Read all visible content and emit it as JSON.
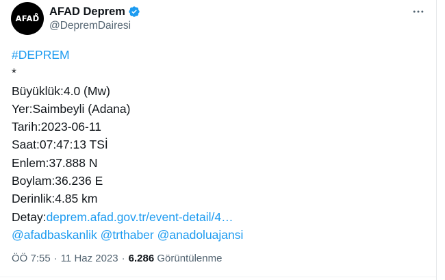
{
  "author": {
    "avatar_text": "AFAD",
    "display_name": "AFAD Deprem",
    "handle": "@DepremDairesi",
    "verified_color": "#1d9bf0"
  },
  "tweet": {
    "hashtag": "#DEPREM",
    "asterisk": "*",
    "magnitude": "Büyüklük:4.0 (Mw)",
    "location": "Yer:Saimbeyli (Adana)",
    "date": "Tarih:2023-06-11",
    "time": "Saat:07:47:13 TSİ",
    "latitude": "Enlem:37.888 N",
    "longitude": "Boylam:36.236 E",
    "depth": "Derinlik:4.85 km",
    "detail_label": "Detay:",
    "detail_link": "deprem.afad.gov.tr/event-detail/4…",
    "mentions": [
      "@afadbaskanlik",
      "@trthaber",
      "@anadoluajansi"
    ]
  },
  "meta": {
    "time": "ÖÖ 7:55",
    "date": "11 Haz 2023",
    "views_count": "6.286",
    "views_label": "Görüntülenme"
  },
  "colors": {
    "link": "#1d9bf0",
    "text": "#0f1419",
    "secondary": "#536471"
  },
  "icons": {
    "verified": "verified-badge-icon",
    "more": "more-options-icon"
  }
}
